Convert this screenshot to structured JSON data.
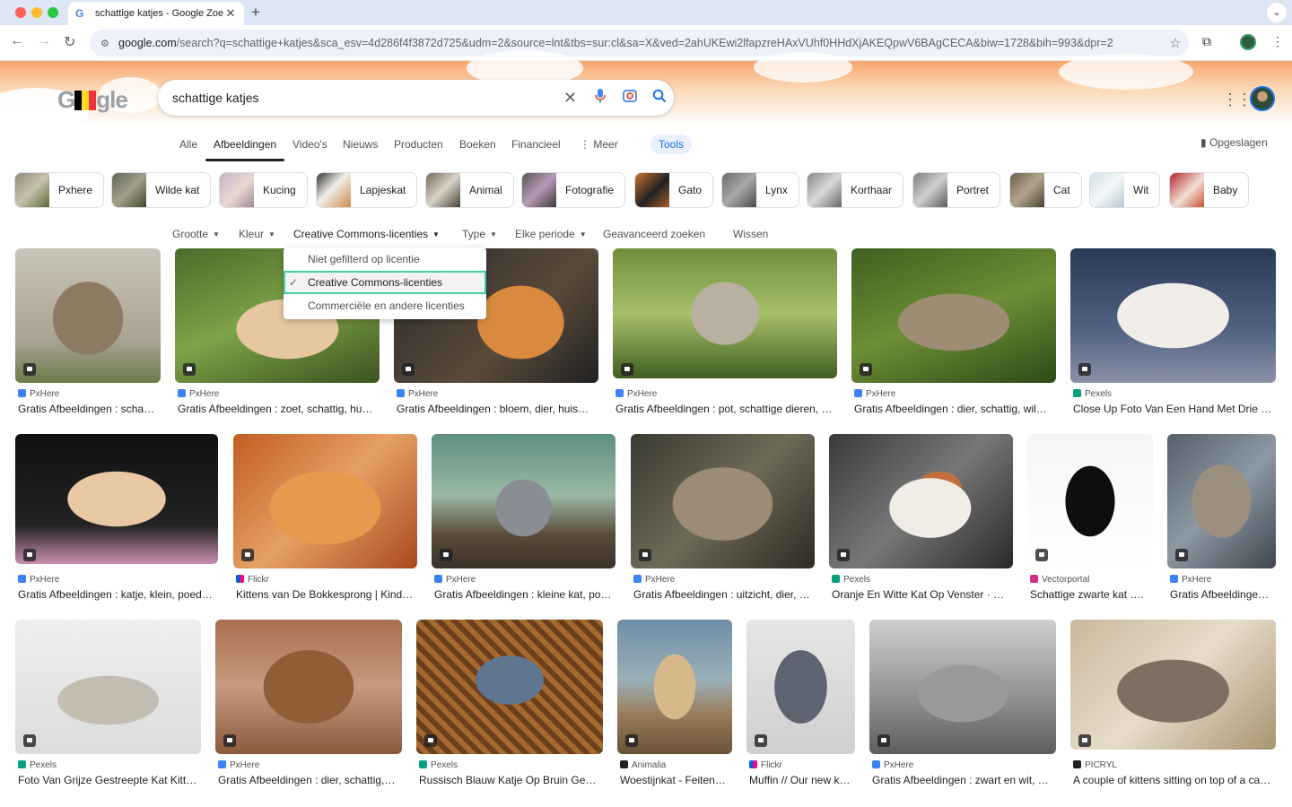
{
  "browser": {
    "tab_title": "schattige katjes - Google Zoe",
    "url_host": "google.com",
    "url_path": "/search?q=schattige+katjes&sca_esv=4d286f4f3872d725&udm=2&source=lnt&tbs=sur:cl&sa=X&ved=2ahUKEwi2lfapzreHAxVUhf0HHdXjAKEQpwV6BAgCECA&biw=1728&bih=993&dpr=2"
  },
  "search": {
    "query": "schattige katjes"
  },
  "logo": {
    "left": "G",
    "right": "gle"
  },
  "nav": {
    "tabs": [
      "Alle",
      "Afbeeldingen",
      "Video's",
      "Nieuws",
      "Producten",
      "Boeken",
      "Financieel",
      "Meer"
    ],
    "tools": "Tools",
    "saved": "Opgeslagen"
  },
  "chips": [
    "Pxhere",
    "Wilde kat",
    "Kucing",
    "Lapjeskat",
    "Animal",
    "Fotografie",
    "Gato",
    "Lynx",
    "Korthaar",
    "Portret",
    "Cat",
    "Wit",
    "Baby"
  ],
  "filters": {
    "size": "Grootte",
    "color": "Kleur",
    "license": "Creative Commons-licenties",
    "type": "Type",
    "period": "Elke periode",
    "advanced": "Geavanceerd zoeken",
    "clear": "Wissen"
  },
  "license_menu": {
    "items": [
      "Niet gefilterd op licentie",
      "Creative Commons-licenties",
      "Commerciële en andere licenties"
    ],
    "selected_index": 1
  },
  "results": [
    {
      "source": "PxHere",
      "title": "Gratis Afbeeldingen : scha…"
    },
    {
      "source": "PxHere",
      "title": "Gratis Afbeeldingen : zoet, schattig, hu…"
    },
    {
      "source": "PxHere",
      "title": "Gratis Afbeeldingen : bloem, dier, huis…"
    },
    {
      "source": "PxHere",
      "title": "Gratis Afbeeldingen : pot, schattige dieren, …"
    },
    {
      "source": "PxHere",
      "title": "Gratis Afbeeldingen : dier, schattig, wil…"
    },
    {
      "source": "Pexels",
      "title": "Close Up Foto Van Een Hand Met Drie …"
    },
    {
      "source": "PxHere",
      "title": "Gratis Afbeeldingen : katje, klein, poed…"
    },
    {
      "source": "Flickr",
      "title": "Kittens van De Bokkesprong | Kind…"
    },
    {
      "source": "PxHere",
      "title": "Gratis Afbeeldingen : kleine kat, po…"
    },
    {
      "source": "PxHere",
      "title": "Gratis Afbeeldingen : uitzicht, dier, …"
    },
    {
      "source": "Pexels",
      "title": "Oranje En Witte Kat Op Venster · …"
    },
    {
      "source": "Vectorportal",
      "title": "Schattige zwarte kat …."
    },
    {
      "source": "PxHere",
      "title": "Gratis Afbeeldinge…"
    },
    {
      "source": "Pexels",
      "title": "Foto Van Grijze Gestreepte Kat Kitt…"
    },
    {
      "source": "PxHere",
      "title": "Gratis Afbeeldingen : dier, schattig,…"
    },
    {
      "source": "Pexels",
      "title": "Russisch Blauw Katje Op Bruin Ge…"
    },
    {
      "source": "Animalia",
      "title": "Woestijnkat - Feiten…"
    },
    {
      "source": "Flickr",
      "title": "Muffin // Our new k…"
    },
    {
      "source": "PxHere",
      "title": "Gratis Afbeeldingen : zwart en wit, …"
    },
    {
      "source": "PICRYL",
      "title": "A couple of kittens sitting on top of a ca…"
    }
  ]
}
